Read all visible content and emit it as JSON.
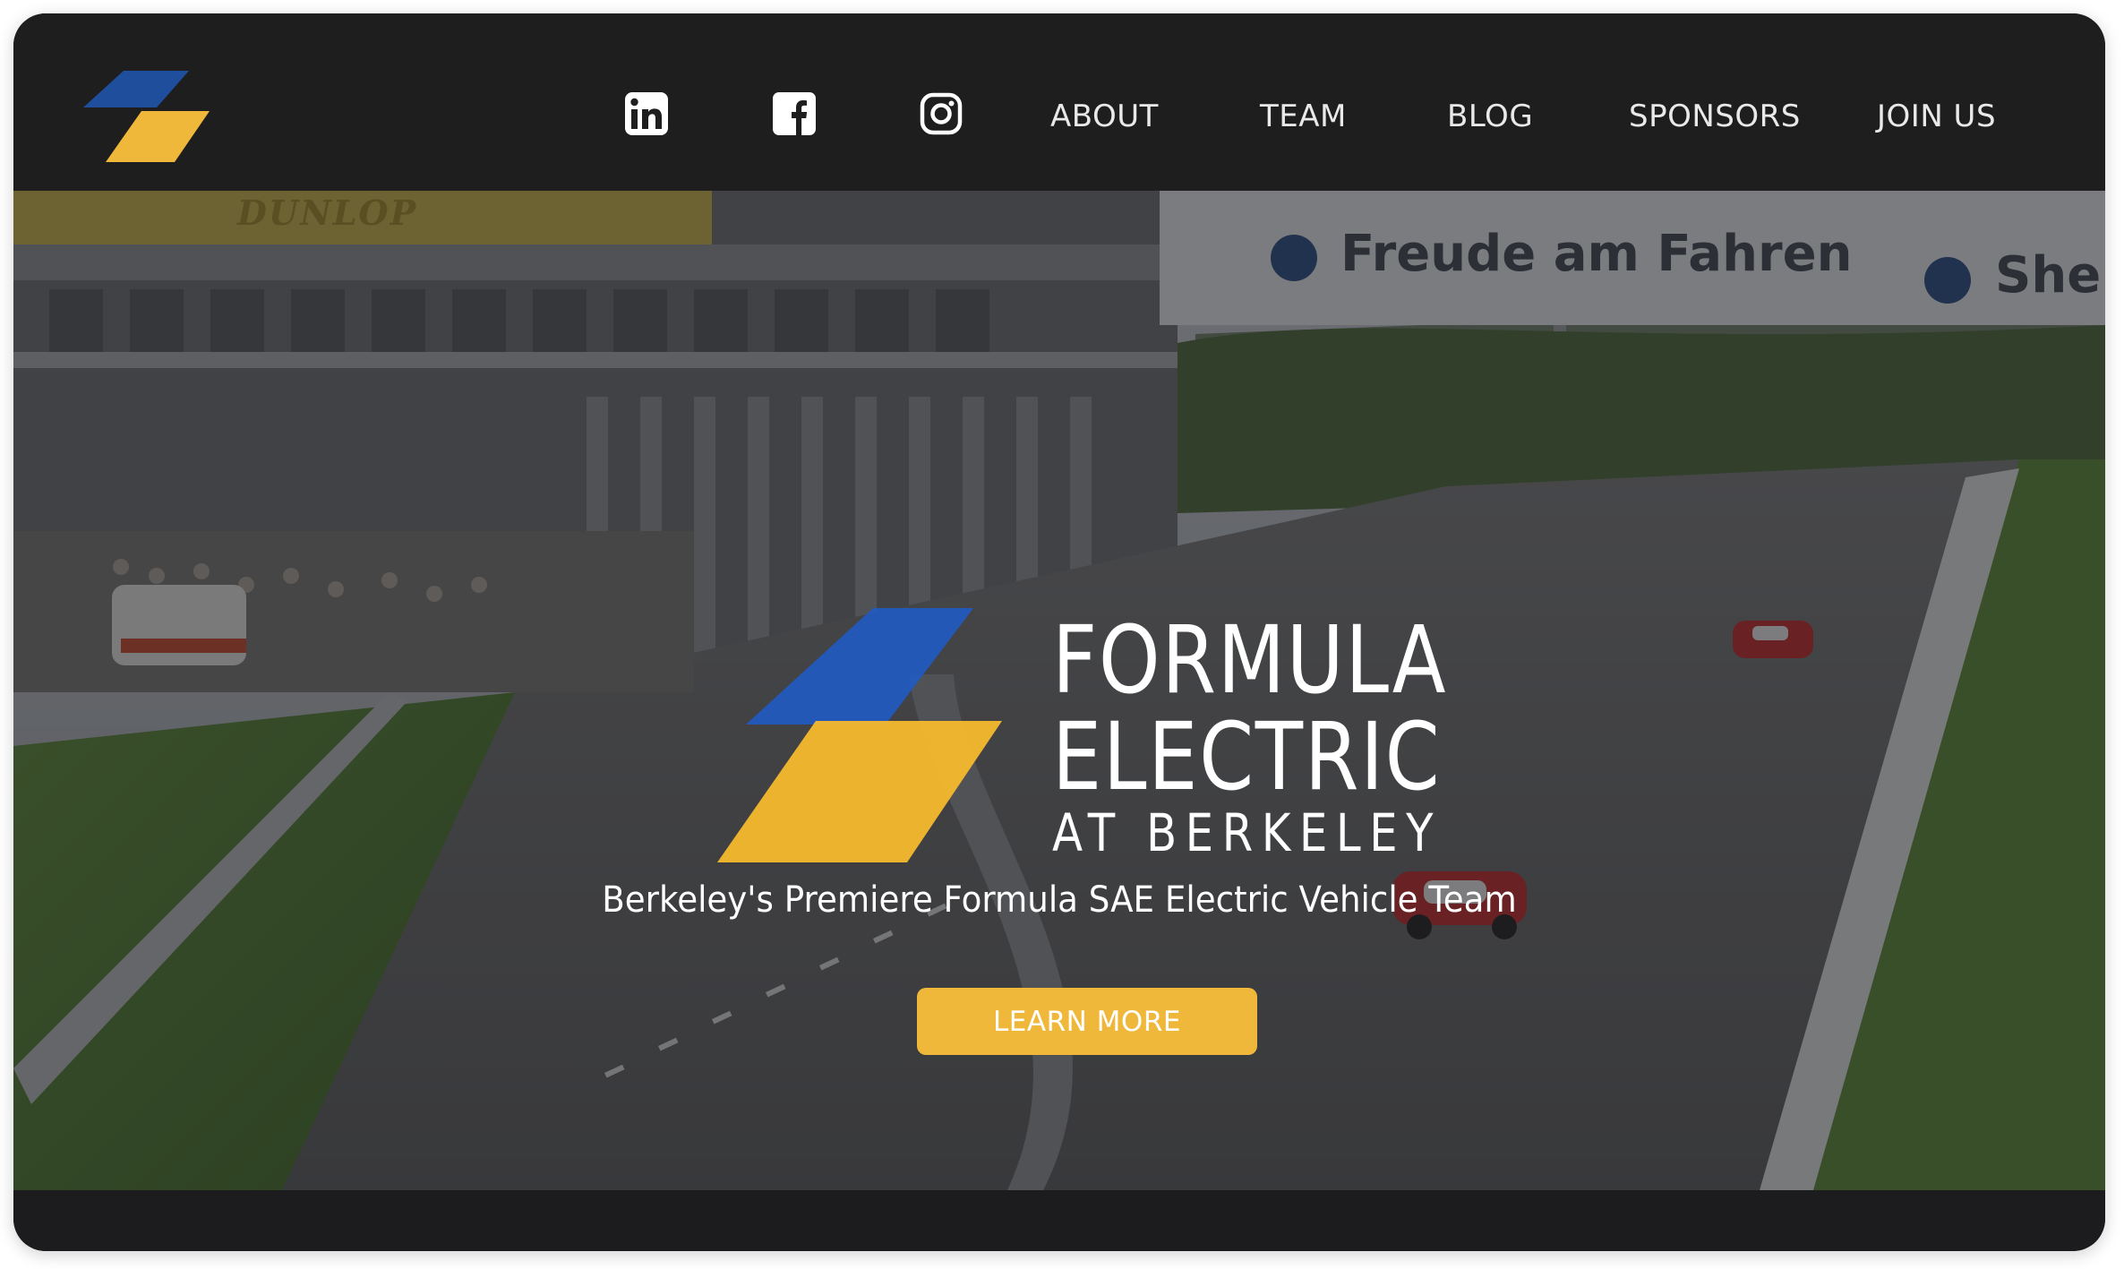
{
  "nav": {
    "social": [
      {
        "icon": "linkedin-icon"
      },
      {
        "icon": "facebook-icon"
      },
      {
        "icon": "instagram-icon"
      }
    ],
    "links": [
      "ABOUT",
      "TEAM",
      "BLOG",
      "SPONSORS",
      "JOIN US"
    ]
  },
  "hero": {
    "title_line1": "FORMULA",
    "title_line2": "ELECTRIC",
    "title_line3": "AT BERKELEY",
    "tagline": "Berkeley's Premiere Formula SAE Electric Vehicle Team",
    "cta_label": "LEARN MORE",
    "background_signage": {
      "left_banner": "DUNLOP",
      "right_banner": "Freude am Fahren",
      "right_banner_cut": "She"
    }
  },
  "colors": {
    "brand_blue": "#1f4e9c",
    "brand_yellow": "#f0b83a",
    "nav_background": "#1e1e1f",
    "nav_text": "#e9e9e9"
  }
}
